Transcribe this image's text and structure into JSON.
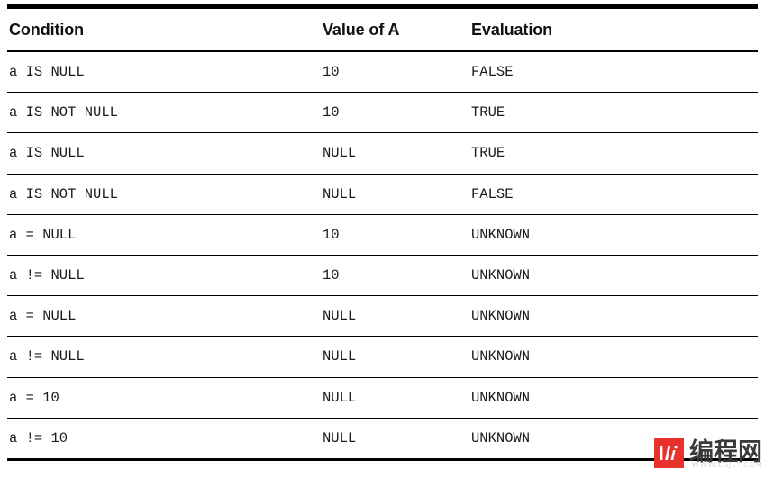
{
  "table": {
    "columns": [
      "Condition",
      "Value of A",
      "Evaluation"
    ],
    "rows": [
      {
        "condition": "a IS NULL",
        "value": "10",
        "evaluation": "FALSE"
      },
      {
        "condition": "a IS NOT NULL",
        "value": "10",
        "evaluation": "TRUE"
      },
      {
        "condition": "a IS NULL",
        "value": "NULL",
        "evaluation": "TRUE"
      },
      {
        "condition": "a IS NOT NULL",
        "value": "NULL",
        "evaluation": "FALSE"
      },
      {
        "condition": "a = NULL",
        "value": "10",
        "evaluation": "UNKNOWN"
      },
      {
        "condition": "a != NULL",
        "value": "10",
        "evaluation": "UNKNOWN"
      },
      {
        "condition": "a = NULL",
        "value": "NULL",
        "evaluation": "UNKNOWN"
      },
      {
        "condition": "a != NULL",
        "value": "NULL",
        "evaluation": "UNKNOWN"
      },
      {
        "condition": "a = 10",
        "value": "NULL",
        "evaluation": "UNKNOWN"
      },
      {
        "condition": "a != 10",
        "value": "NULL",
        "evaluation": "UNKNOWN"
      }
    ]
  },
  "watermark": {
    "logo_icon": "bar-chart-icon",
    "text": "编程网",
    "subtext": "WWW.LSJLT.COM",
    "logo_color": "#e8312a",
    "text_color": "#3a3a3a"
  }
}
